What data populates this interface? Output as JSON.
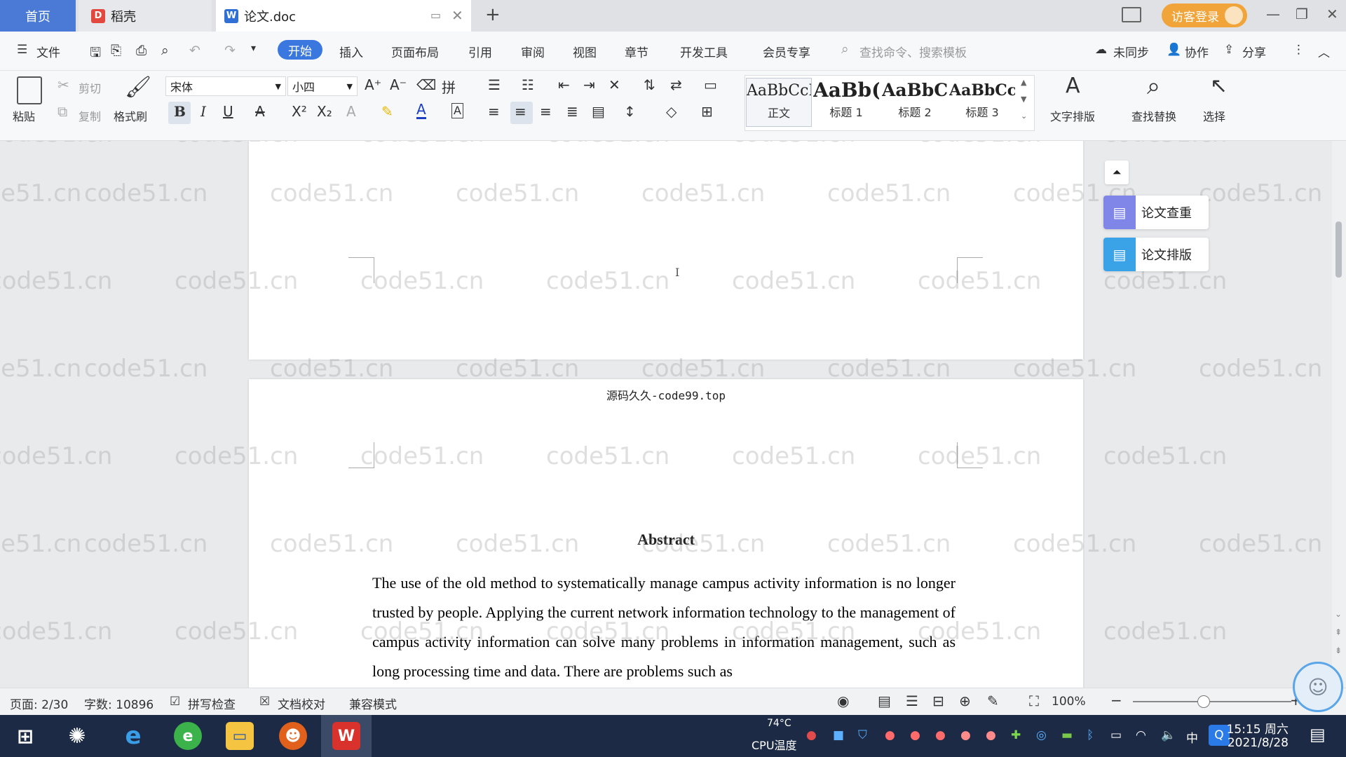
{
  "tabs": {
    "home": "首页",
    "daoke": "稻壳",
    "doc": "论文.doc",
    "new_tab": "+"
  },
  "titlebar": {
    "login": "访客登录",
    "minimize": "—",
    "restore": "❐",
    "close": "✕"
  },
  "menu": {
    "file": "文件",
    "items": [
      "开始",
      "插入",
      "页面布局",
      "引用",
      "审阅",
      "视图",
      "章节",
      "开发工具",
      "会员专享"
    ],
    "search_placeholder": "查找命令、搜索模板",
    "sync": "未同步",
    "collab": "协作",
    "share": "分享"
  },
  "ribbon": {
    "paste": "粘贴",
    "cut": "剪切",
    "copy": "复制",
    "format_painter": "格式刷",
    "font_name": "宋体",
    "font_size": "小四",
    "styles": [
      {
        "sample": "AaBbCcI",
        "name": "正文"
      },
      {
        "sample": "AaBb(",
        "name": "标题 1"
      },
      {
        "sample": "AaBbC",
        "name": "标题 2"
      },
      {
        "sample": "AaBbCcl",
        "name": "标题 3"
      }
    ],
    "text_layout": "文字排版",
    "find_replace": "查找替换",
    "select": "选择"
  },
  "side_panel": {
    "check": "论文查重",
    "layout": "论文排版"
  },
  "document": {
    "header_text": "源码久久-code99.top",
    "abstract_title": "Abstract",
    "abstract_body": "The use of the old method to systematically manage campus activity information is no longer trusted by people. Applying the current network information technology to the management of campus activity information can solve many problems in information management, such as long processing time and data. There are problems such as",
    "cursor": "I"
  },
  "watermark": "code51.cn",
  "statusbar": {
    "page": "页面: 2/30",
    "words": "字数: 10896",
    "spell": "拼写检查",
    "proof": "文档校对",
    "compat": "兼容模式",
    "zoom": "100%"
  },
  "taskbar": {
    "cpu_temp": "74°C",
    "cpu_label": "CPU温度",
    "ime": "中",
    "time": "15:15 周六",
    "date": "2021/8/28"
  },
  "colors": {
    "accent": "#3a78e0",
    "home_tab": "#4a79d6",
    "login": "#f0a43a",
    "taskbar": "#1c2a45"
  }
}
